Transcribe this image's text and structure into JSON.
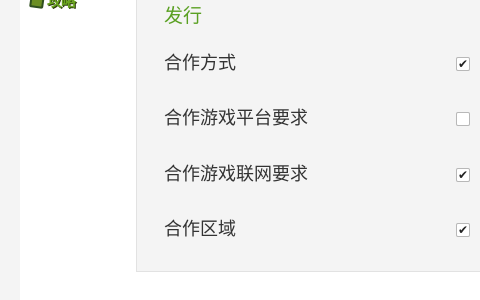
{
  "logo": {
    "text": "攻略"
  },
  "section": {
    "title": "发行"
  },
  "options": [
    {
      "label": "合作方式",
      "checked": true
    },
    {
      "label": "合作游戏平台要求",
      "checked": false
    },
    {
      "label": "合作游戏联网要求",
      "checked": true
    },
    {
      "label": "合作区域",
      "checked": true
    }
  ],
  "check_glyph": "✔",
  "icons": {
    "checkbox_checked": "checkmark-icon"
  },
  "colors": {
    "title": "#5aa022",
    "label": "#333333",
    "panel": "#f4f4f4"
  }
}
